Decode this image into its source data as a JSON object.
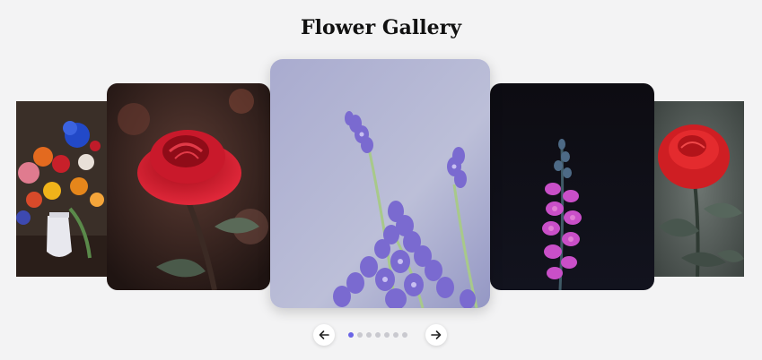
{
  "gallery": {
    "title": "Flower Gallery",
    "active_index": 0,
    "slides": [
      {
        "name": "flower-bouquet-vase",
        "position": "far-left"
      },
      {
        "name": "red-rose-dark",
        "position": "left"
      },
      {
        "name": "lavender",
        "position": "center"
      },
      {
        "name": "pink-flower-dark",
        "position": "right"
      },
      {
        "name": "red-rose-greenery",
        "position": "far-right"
      }
    ],
    "dots_count": 7,
    "prev_icon": "arrow-left-icon",
    "next_icon": "arrow-right-icon"
  },
  "colors": {
    "background": "#f3f3f4",
    "active_dot": "#6a64e6",
    "inactive_dot": "#c9c9cf"
  }
}
